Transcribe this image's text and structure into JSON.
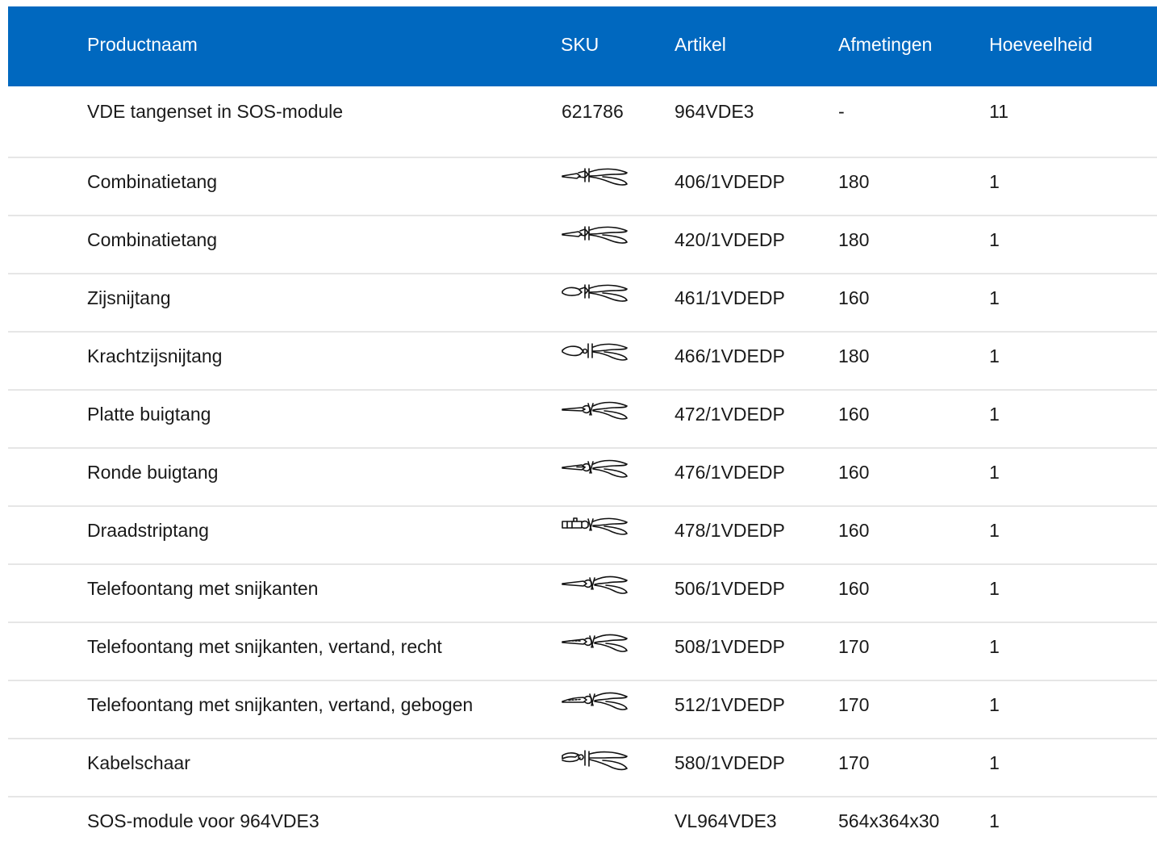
{
  "table": {
    "headers": {
      "name": "Productnaam",
      "sku": "SKU",
      "article": "Artikel",
      "dimensions": "Afmetingen",
      "quantity": "Hoeveelheid"
    },
    "rows": [
      {
        "name": "VDE tangenset in SOS-module",
        "sku": "621786",
        "article": "964VDE3",
        "dimensions": "-",
        "quantity": "11"
      },
      {
        "name": "Combinatietang",
        "sku_icon": "combination-pliers-icon",
        "article": "406/1VDEDP",
        "dimensions": "180",
        "quantity": "1"
      },
      {
        "name": "Combinatietang",
        "sku_icon": "combination-pliers-icon",
        "article": "420/1VDEDP",
        "dimensions": "180",
        "quantity": "1"
      },
      {
        "name": "Zijsnijtang",
        "sku_icon": "side-cutter-icon",
        "article": "461/1VDEDP",
        "dimensions": "160",
        "quantity": "1"
      },
      {
        "name": "Krachtzijsnijtang",
        "sku_icon": "power-side-cutter-icon",
        "article": "466/1VDEDP",
        "dimensions": "180",
        "quantity": "1"
      },
      {
        "name": "Platte buigtang",
        "sku_icon": "flat-nose-pliers-icon",
        "article": "472/1VDEDP",
        "dimensions": "160",
        "quantity": "1"
      },
      {
        "name": "Ronde buigtang",
        "sku_icon": "round-nose-pliers-icon",
        "article": "476/1VDEDP",
        "dimensions": "160",
        "quantity": "1"
      },
      {
        "name": "Draadstriptang",
        "sku_icon": "wire-stripper-icon",
        "article": "478/1VDEDP",
        "dimensions": "160",
        "quantity": "1"
      },
      {
        "name": "Telefoontang met snijkanten",
        "sku_icon": "telephone-pliers-icon",
        "article": "506/1VDEDP",
        "dimensions": "160",
        "quantity": "1"
      },
      {
        "name": "Telefoontang met snijkanten, vertand, recht",
        "sku_icon": "telephone-pliers-icon",
        "article": "508/1VDEDP",
        "dimensions": "170",
        "quantity": "1"
      },
      {
        "name": "Telefoontang met snijkanten, vertand, gebogen",
        "sku_icon": "bent-telephone-pliers-icon",
        "article": "512/1VDEDP",
        "dimensions": "170",
        "quantity": "1"
      },
      {
        "name": "Kabelschaar",
        "sku_icon": "cable-shears-icon",
        "article": "580/1VDEDP",
        "dimensions": "170",
        "quantity": "1"
      },
      {
        "name": "SOS-module voor 964VDE3",
        "sku": "",
        "article": "VL964VDE3",
        "dimensions": "564x364x30",
        "quantity": "1"
      }
    ]
  },
  "colors": {
    "header_bg": "#0068bf",
    "header_text": "#ffffff",
    "row_divider": "#e6e6e6",
    "body_text": "#1a1a1a"
  }
}
